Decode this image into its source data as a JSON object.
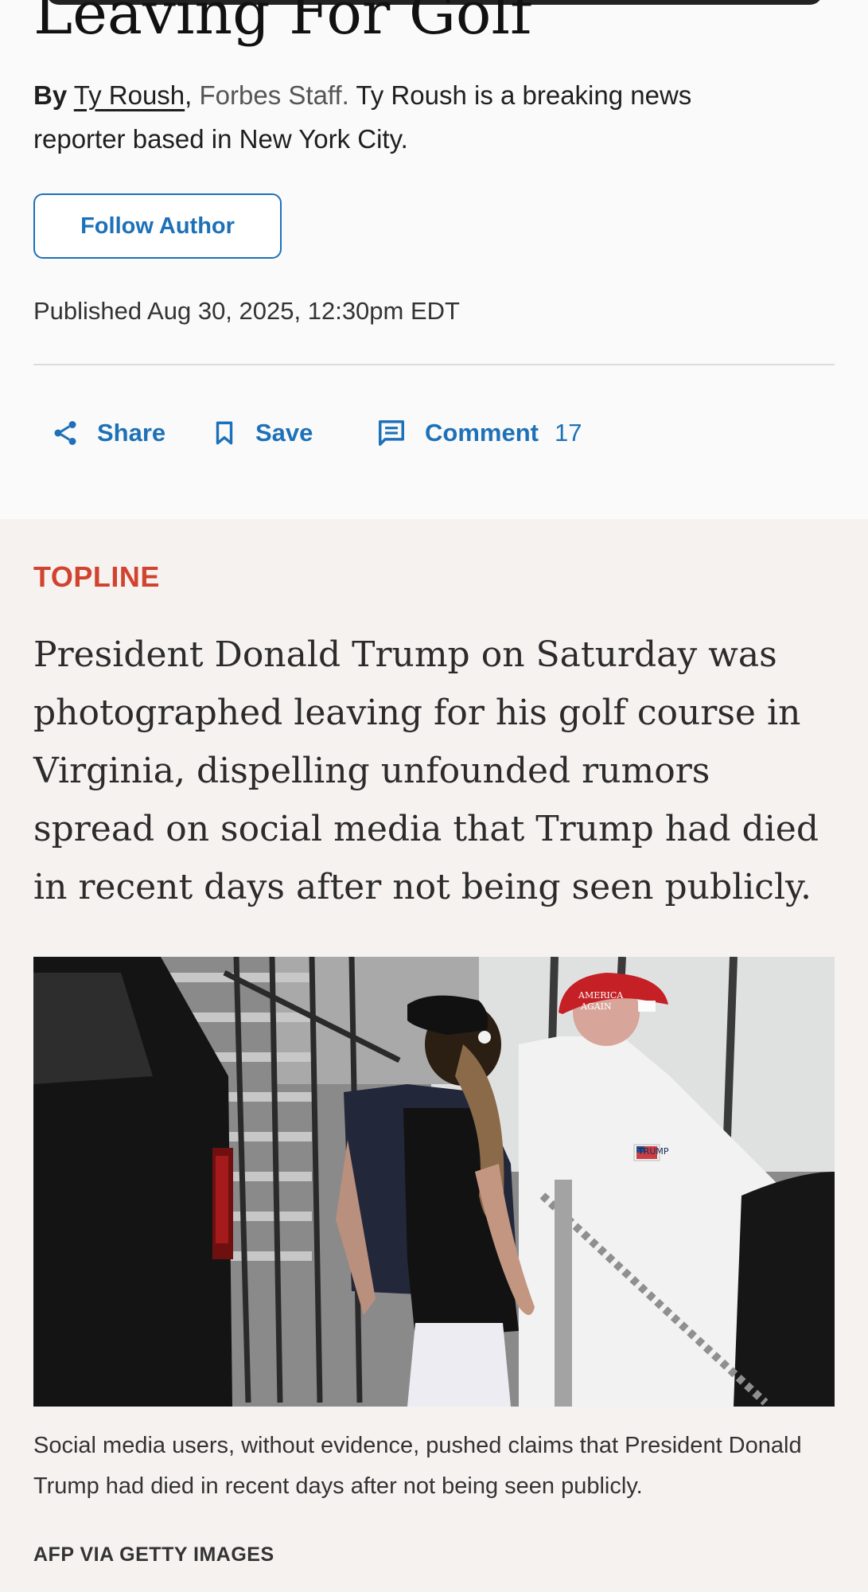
{
  "article": {
    "headline_fragment": "Leaving For Golf",
    "byline": {
      "by": "By",
      "author": "Ty Roush",
      "comma": ",",
      "staff": "Forbes Staff.",
      "bio": "Ty Roush is a breaking news reporter based in New York City."
    },
    "follow_button": "Follow Author",
    "published": "Published Aug 30, 2025, 12:30pm EDT"
  },
  "actions": {
    "share": "Share",
    "save": "Save",
    "comment": "Comment",
    "comment_count": "17"
  },
  "story": {
    "topline_label": "TOPLINE",
    "topline_text": "President Donald Trump on Saturday was photographed leaving for his golf course in Virginia, dispelling unfounded rumors spread on social media that Trump had died in recent days after not being seen publicly.",
    "photo": {
      "cap_text_line1": "AMERICA",
      "cap_text_line2": "AGAIN",
      "shirt_logo": "TRUMP",
      "caption": "Social media users, without evidence, pushed claims that President Donald Trump had died in recent days after not being seen publicly.",
      "credit": "AFP VIA GETTY IMAGES"
    }
  },
  "colors": {
    "accent_blue": "#1d71b8",
    "topline_red": "#d1432f",
    "story_background": "#f6f2f0"
  },
  "icons": {
    "share": "share-icon",
    "save": "bookmark-icon",
    "comment": "comment-icon"
  }
}
